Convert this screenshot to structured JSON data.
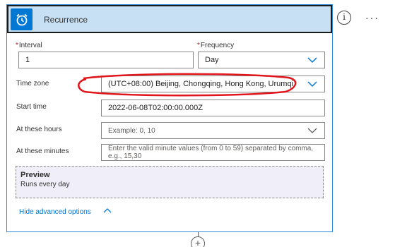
{
  "header": {
    "title": "Recurrence",
    "icon": "alarm-clock-icon"
  },
  "actions": {
    "info_label": "i",
    "more_label": "···"
  },
  "interval": {
    "label": "Interval",
    "required": "*",
    "value": "1"
  },
  "frequency": {
    "label": "Frequency",
    "required": "*",
    "value": "Day"
  },
  "timezone": {
    "label": "Time zone",
    "value": "(UTC+08:00) Beijing, Chongqing, Hong Kong, Urumqi"
  },
  "start_time": {
    "label": "Start time",
    "value": "2022-06-08T02:00:00.000Z"
  },
  "hours": {
    "label": "At these hours",
    "placeholder": "Example: 0, 10"
  },
  "minutes": {
    "label": "At these minutes",
    "placeholder": "Enter the valid minute values (from 0 to 59) separated by comma, e.g., 15,30"
  },
  "preview": {
    "title": "Preview",
    "text": "Runs every day"
  },
  "advanced": {
    "label": "Hide advanced options"
  },
  "add": {
    "label": "+"
  },
  "colors": {
    "accent": "#0078d4",
    "header_bg": "#c7e0f4",
    "annotation": "#e0161c",
    "preview_bg": "#f0eef8"
  }
}
